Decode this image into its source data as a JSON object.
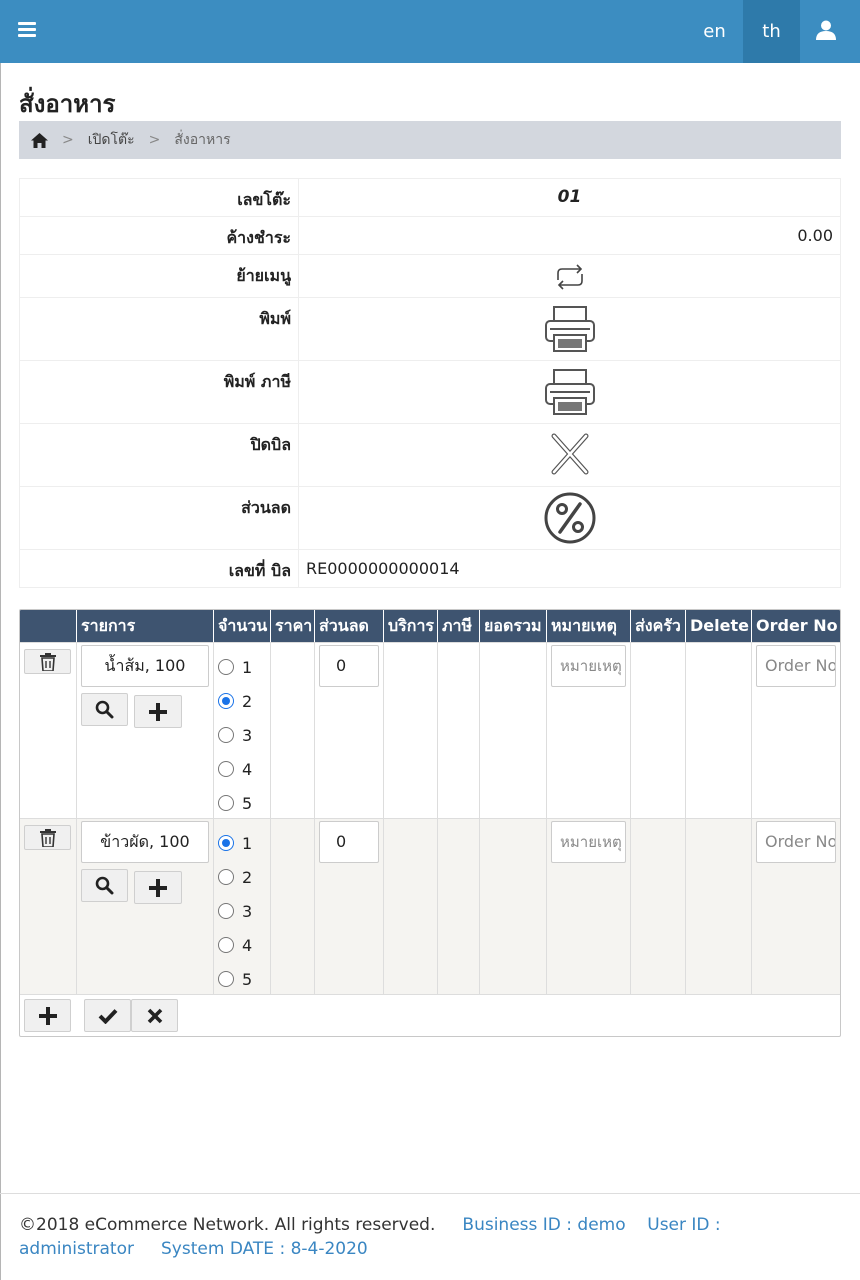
{
  "navbar": {
    "lang_en": "en",
    "lang_th": "th",
    "accent_color": "#3c8dc1",
    "menu_icon": "hamburger-icon",
    "user_icon": "user-icon"
  },
  "page": {
    "title": "สั่งอาหาร"
  },
  "breadcrumb": {
    "home_icon": "home-icon",
    "sep": ">",
    "items": [
      "เปิดโต๊ะ",
      "สั่งอาหาร"
    ]
  },
  "info": {
    "table_no_label": "เลขโต๊ะ",
    "table_no_value": "01",
    "outstanding_label": "ค้างชำระ",
    "outstanding_value": "0.00",
    "move_menu_label": "ย้ายเมนู",
    "print_label": "พิมพ์",
    "print_tax_label": "พิมพ์ ภาษี",
    "close_bill_label": "ปิดบิล",
    "discount_label": "ส่วนลด",
    "bill_no_label": "เลขที่ บิล",
    "bill_no_value": "RE0000000000014"
  },
  "order_table": {
    "headers": [
      "",
      "รายการ",
      "จำนวน",
      "ราคา",
      "ส่วนลด",
      "บริการ",
      "ภาษี",
      "ยอดรวม",
      "หมายเหตุ",
      "ส่งครัว",
      "Delete",
      "Order No"
    ],
    "header_color": "#3e5470",
    "quantity_options": [
      "1",
      "2",
      "3",
      "4",
      "5"
    ],
    "rows": [
      {
        "item": "น้ำส้ม, 100",
        "selected_qty": "2",
        "discount": "0",
        "note_placeholder": "หมายเหตุ",
        "order_no_placeholder": "Order No"
      },
      {
        "item": "ข้าวผัด, 100",
        "selected_qty": "1",
        "discount": "0",
        "note_placeholder": "หมายเหตุ",
        "order_no_placeholder": "Order No"
      }
    ]
  },
  "footer": {
    "copyright": "©2018 eCommerce Network. All rights reserved.",
    "business_id": "Business ID : demo",
    "user_id": "User ID : administrator",
    "system_date": "System DATE : 8-4-2020"
  }
}
